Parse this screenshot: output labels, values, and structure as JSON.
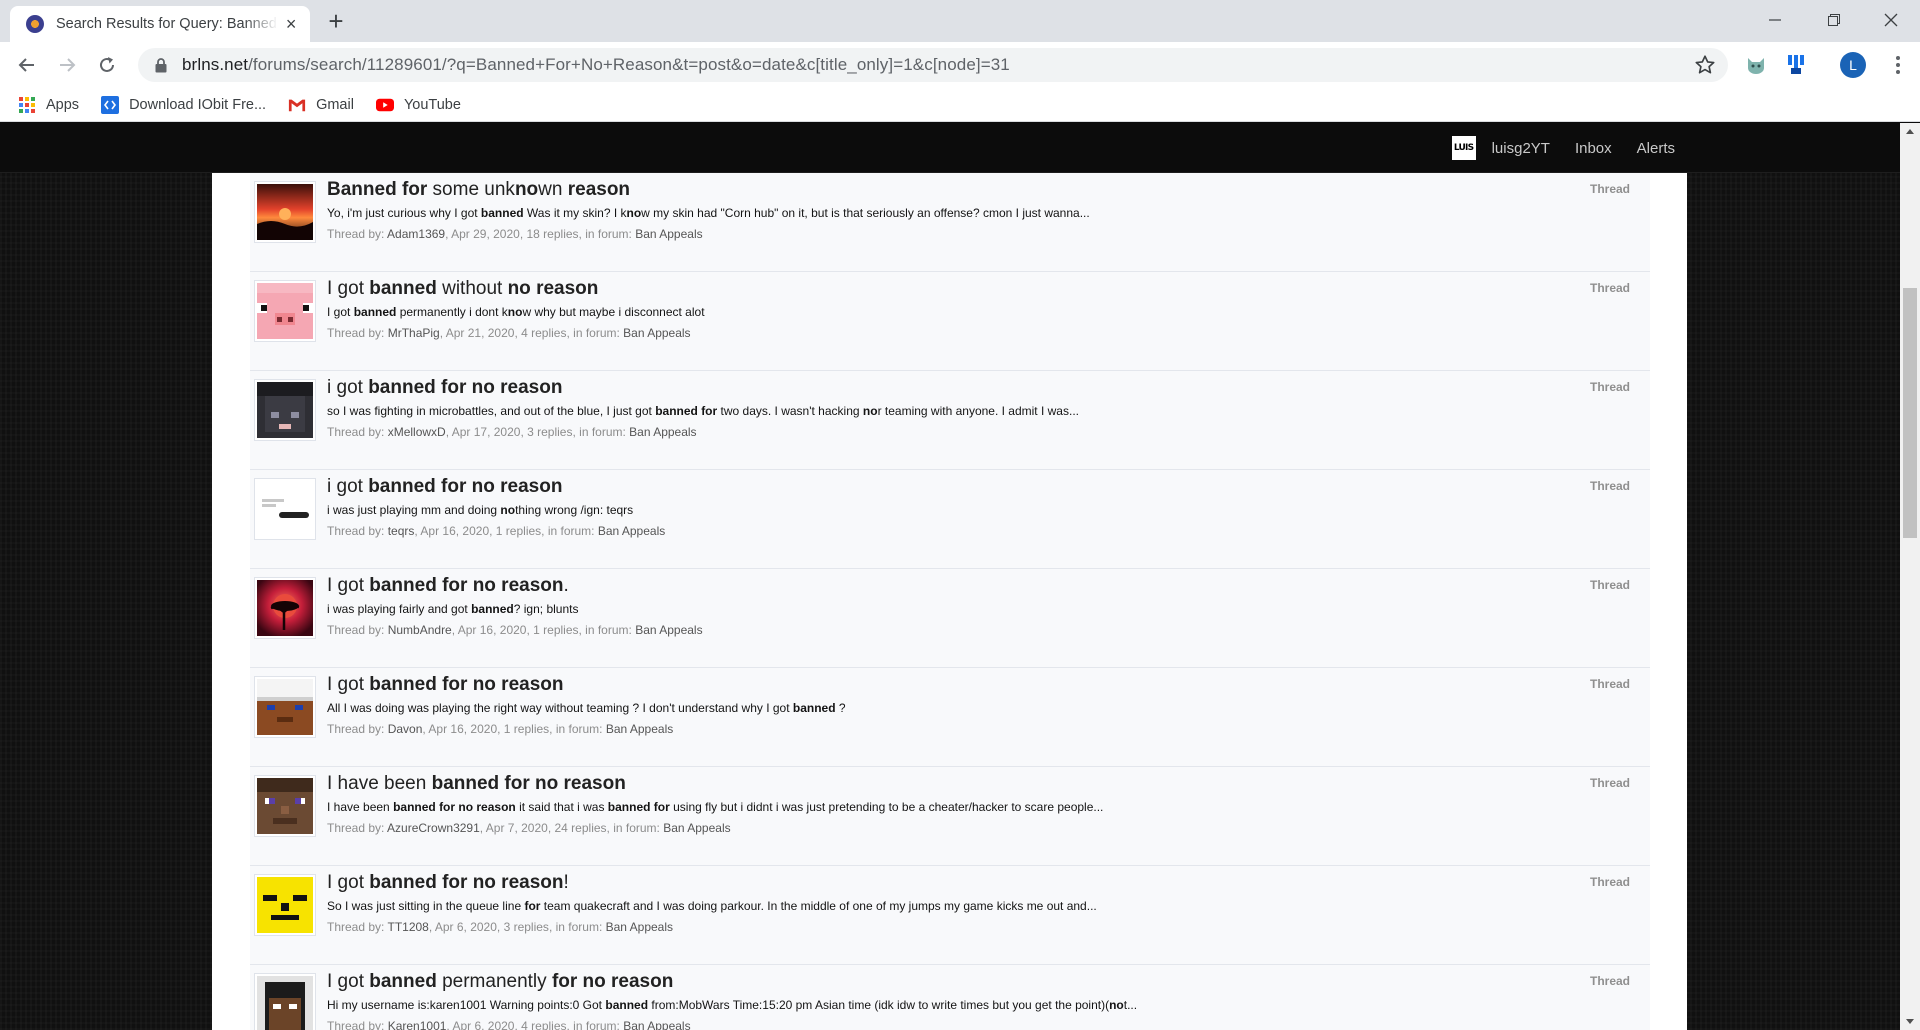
{
  "browser": {
    "tab_title": "Search Results for Query: Banned For No Reason",
    "tab_close": "×",
    "new_tab": "+",
    "url_host": "brlns.net",
    "url_path": "/forums/search/11289601/?q=Banned+For+No+Reason&t=post&o=date&c[title_only]=1&c[node]=31",
    "profile_initial": "L",
    "bookmarks": [
      {
        "label": "Apps",
        "icon": "apps-grid-icon"
      },
      {
        "label": "Download IObit Fre...",
        "icon": "iobit-icon"
      },
      {
        "label": "Gmail",
        "icon": "gmail-icon"
      },
      {
        "label": "YouTube",
        "icon": "youtube-icon"
      }
    ]
  },
  "site_header": {
    "user_badge": "LUIS",
    "username": "luisg2YT",
    "inbox": "Inbox",
    "alerts": "Alerts"
  },
  "results": [
    {
      "title": [
        {
          "t": "Banned for",
          "b": true
        },
        {
          "t": " some unk",
          "b": false
        },
        {
          "t": "no",
          "b": true
        },
        {
          "t": "wn ",
          "b": false
        },
        {
          "t": "reason",
          "b": true
        }
      ],
      "snippet": [
        {
          "t": "Yo, i'm just curious why I got ",
          "b": false
        },
        {
          "t": "banned",
          "b": true
        },
        {
          "t": " Was it my skin? I k",
          "b": false
        },
        {
          "t": "no",
          "b": true
        },
        {
          "t": "w my skin had \"Corn hub\" on it, but is that seriously an offense? cmon I just wanna...",
          "b": false
        }
      ],
      "author": "Adam1369",
      "date": "Apr 29, 2020",
      "replies": "18 replies",
      "forum": "Ban Appeals",
      "type": "Thread",
      "thumb": "sunset"
    },
    {
      "title": [
        {
          "t": "I got ",
          "b": false
        },
        {
          "t": "banned",
          "b": true
        },
        {
          "t": " without ",
          "b": false
        },
        {
          "t": "no reason",
          "b": true
        }
      ],
      "snippet": [
        {
          "t": "I got ",
          "b": false
        },
        {
          "t": "banned",
          "b": true
        },
        {
          "t": " permanently i dont k",
          "b": false
        },
        {
          "t": "no",
          "b": true
        },
        {
          "t": "w why but maybe i disconnect alot",
          "b": false
        }
      ],
      "author": "MrThaPig",
      "date": "Apr 21, 2020",
      "replies": "4 replies",
      "forum": "Ban Appeals",
      "type": "Thread",
      "thumb": "pig"
    },
    {
      "title": [
        {
          "t": "i got ",
          "b": false
        },
        {
          "t": "banned for no reason",
          "b": true
        }
      ],
      "snippet": [
        {
          "t": "so I was fighting in microbattles, and out of the blue, I just got ",
          "b": false
        },
        {
          "t": "banned for",
          "b": true
        },
        {
          "t": " two days. I wasn't hacking ",
          "b": false
        },
        {
          "t": "no",
          "b": true
        },
        {
          "t": "r teaming with anyone. I admit I was...",
          "b": false
        }
      ],
      "author": "xMellowxD",
      "date": "Apr 17, 2020",
      "replies": "3 replies",
      "forum": "Ban Appeals",
      "type": "Thread",
      "thumb": "dark-skin"
    },
    {
      "title": [
        {
          "t": "i got ",
          "b": false
        },
        {
          "t": "banned for no reason",
          "b": true
        }
      ],
      "snippet": [
        {
          "t": "i was just playing mm and doing ",
          "b": false
        },
        {
          "t": "no",
          "b": true
        },
        {
          "t": "thing wrong /ign: teqrs",
          "b": false
        }
      ],
      "author": "teqrs",
      "date": "Apr 16, 2020",
      "replies": "1 replies",
      "forum": "Ban Appeals",
      "type": "Thread",
      "thumb": "screenshot"
    },
    {
      "title": [
        {
          "t": "I got ",
          "b": false
        },
        {
          "t": "banned for no reason",
          "b": true
        },
        {
          "t": ".",
          "b": false
        }
      ],
      "snippet": [
        {
          "t": "i was playing fairly and got ",
          "b": false
        },
        {
          "t": "banned",
          "b": true
        },
        {
          "t": "? ign; blunts",
          "b": false
        }
      ],
      "author": "NumbAndre",
      "date": "Apr 16, 2020",
      "replies": "1 replies",
      "forum": "Ban Appeals",
      "type": "Thread",
      "thumb": "red-tree"
    },
    {
      "title": [
        {
          "t": "I got ",
          "b": false
        },
        {
          "t": "banned for no reason",
          "b": true
        }
      ],
      "snippet": [
        {
          "t": "All I was doing was playing the right way without teaming ? I don't understand why I got ",
          "b": false
        },
        {
          "t": "banned",
          "b": true
        },
        {
          "t": " ?",
          "b": false
        }
      ],
      "author": "Davon",
      "date": "Apr 16, 2020",
      "replies": "1 replies",
      "forum": "Ban Appeals",
      "type": "Thread",
      "thumb": "chef"
    },
    {
      "title": [
        {
          "t": "I have been ",
          "b": false
        },
        {
          "t": "banned for no reason",
          "b": true
        }
      ],
      "snippet": [
        {
          "t": "I have been ",
          "b": false
        },
        {
          "t": "banned for no reason",
          "b": true
        },
        {
          "t": " it said that i was ",
          "b": false
        },
        {
          "t": "banned for",
          "b": true
        },
        {
          "t": " using fly but i didnt i was just pretending to be a cheater/hacker to scare people...",
          "b": false
        }
      ],
      "author": "AzureCrown3291",
      "date": "Apr 7, 2020",
      "replies": "24 replies",
      "forum": "Ban Appeals",
      "type": "Thread",
      "thumb": "villager"
    },
    {
      "title": [
        {
          "t": "I got ",
          "b": false
        },
        {
          "t": "banned for no reason",
          "b": true
        },
        {
          "t": "!",
          "b": false
        }
      ],
      "snippet": [
        {
          "t": "So I was just sitting in the queue line ",
          "b": false
        },
        {
          "t": "for",
          "b": true
        },
        {
          "t": " team quakecraft and I was doing parkour. In the middle of one of my jumps my game kicks me out and...",
          "b": false
        }
      ],
      "author": "TT1208",
      "date": "Apr 6, 2020",
      "replies": "3 replies",
      "forum": "Ban Appeals",
      "type": "Thread",
      "thumb": "yellow-face"
    },
    {
      "title": [
        {
          "t": "I got ",
          "b": false
        },
        {
          "t": "banned",
          "b": true
        },
        {
          "t": " permanently ",
          "b": false
        },
        {
          "t": "for no reason",
          "b": true
        }
      ],
      "snippet": [
        {
          "t": "Hi my username is:karen1001 Warning points:0 Got ",
          "b": false
        },
        {
          "t": "banned",
          "b": true
        },
        {
          "t": " from:MobWars Time:15:20 pm Asian time (idk idw to write times but you get the point)(",
          "b": false
        },
        {
          "t": "no",
          "b": true
        },
        {
          "t": "t...",
          "b": false
        }
      ],
      "author": "Karen1001",
      "date": "Apr 6, 2020",
      "replies": "4 replies",
      "forum": "Ban Appeals",
      "type": "Thread",
      "thumb": "dark-face"
    }
  ],
  "meta_labels": {
    "thread_by": "Thread by: ",
    "in_forum": ", in forum: "
  }
}
